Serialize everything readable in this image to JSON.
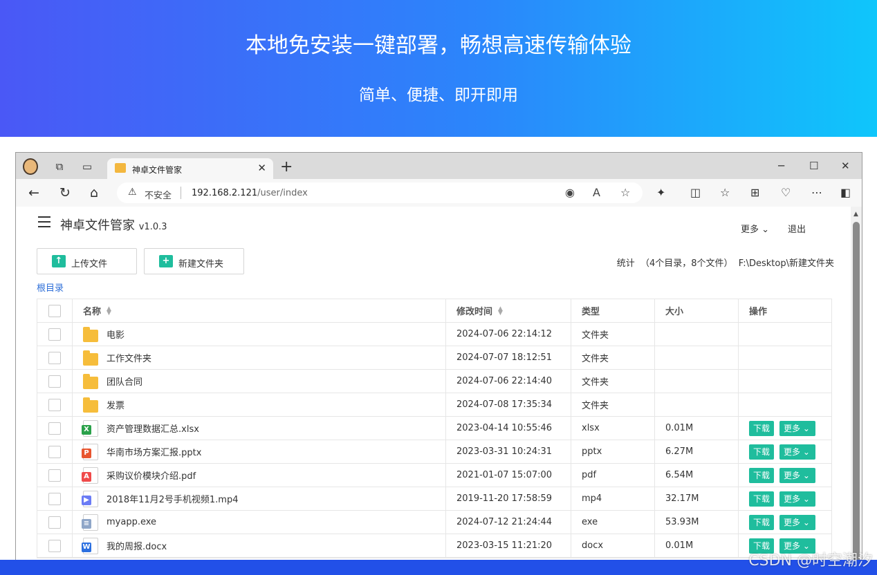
{
  "hero": {
    "title": "本地免安装一键部署，畅想高速传输体验",
    "subtitle": "简单、便捷、即开即用"
  },
  "browser": {
    "tab_title": "神卓文件管家",
    "security_text": "不安全",
    "url_host": "192.168.2.121",
    "url_path": "/user/index"
  },
  "app": {
    "name": "神卓文件管家",
    "version": "v1.0.3",
    "more_label": "更多",
    "logout_label": "退出",
    "upload_label": "上传文件",
    "new_folder_label": "新建文件夹",
    "stats_text": "统计  （4个目录，8个文件）  F:\\Desktop\\新建文件夹",
    "root_link": "根目录"
  },
  "table": {
    "columns": {
      "name": "名称",
      "modified": "修改时间",
      "type": "类型",
      "size": "大小",
      "actions": "操作"
    },
    "download_label": "下载",
    "more_label": "更多",
    "rows": [
      {
        "name": "电影",
        "modified": "2024-07-06 22:14:12",
        "type": "文件夹",
        "size": "",
        "icon": "folder-icon"
      },
      {
        "name": "工作文件夹",
        "modified": "2024-07-07 18:12:51",
        "type": "文件夹",
        "size": "",
        "icon": "folder-icon"
      },
      {
        "name": "团队合同",
        "modified": "2024-07-06 22:14:40",
        "type": "文件夹",
        "size": "",
        "icon": "folder-icon"
      },
      {
        "name": "发票",
        "modified": "2024-07-08 17:35:34",
        "type": "文件夹",
        "size": "",
        "icon": "folder-icon"
      },
      {
        "name": "资产管理数据汇总.xlsx",
        "modified": "2023-04-14 10:55:46",
        "type": "xlsx",
        "size": "0.01M",
        "icon": "excel-file-icon",
        "badge": "X",
        "color": "#2aa14a"
      },
      {
        "name": "华南市场方案汇报.pptx",
        "modified": "2023-03-31 10:24:31",
        "type": "pptx",
        "size": "6.27M",
        "icon": "powerpoint-file-icon",
        "badge": "P",
        "color": "#e8552f"
      },
      {
        "name": "采购议价模块介绍.pdf",
        "modified": "2021-01-07 15:07:00",
        "type": "pdf",
        "size": "6.54M",
        "icon": "pdf-file-icon",
        "badge": "A",
        "color": "#f04a4a"
      },
      {
        "name": "2018年11月2号手机视频1.mp4",
        "modified": "2019-11-20 17:58:59",
        "type": "mp4",
        "size": "32.17M",
        "icon": "video-file-icon",
        "badge": "▶",
        "color": "#6b7cf5"
      },
      {
        "name": "myapp.exe",
        "modified": "2024-07-12 21:24:44",
        "type": "exe",
        "size": "53.93M",
        "icon": "exe-file-icon",
        "badge": "≡",
        "color": "#8fa6c8"
      },
      {
        "name": "我的周报.docx",
        "modified": "2023-03-15 11:21:20",
        "type": "docx",
        "size": "0.01M",
        "icon": "word-file-icon",
        "badge": "W",
        "color": "#2b6fe0"
      }
    ]
  },
  "watermark": "CSDN @时空潮汐"
}
